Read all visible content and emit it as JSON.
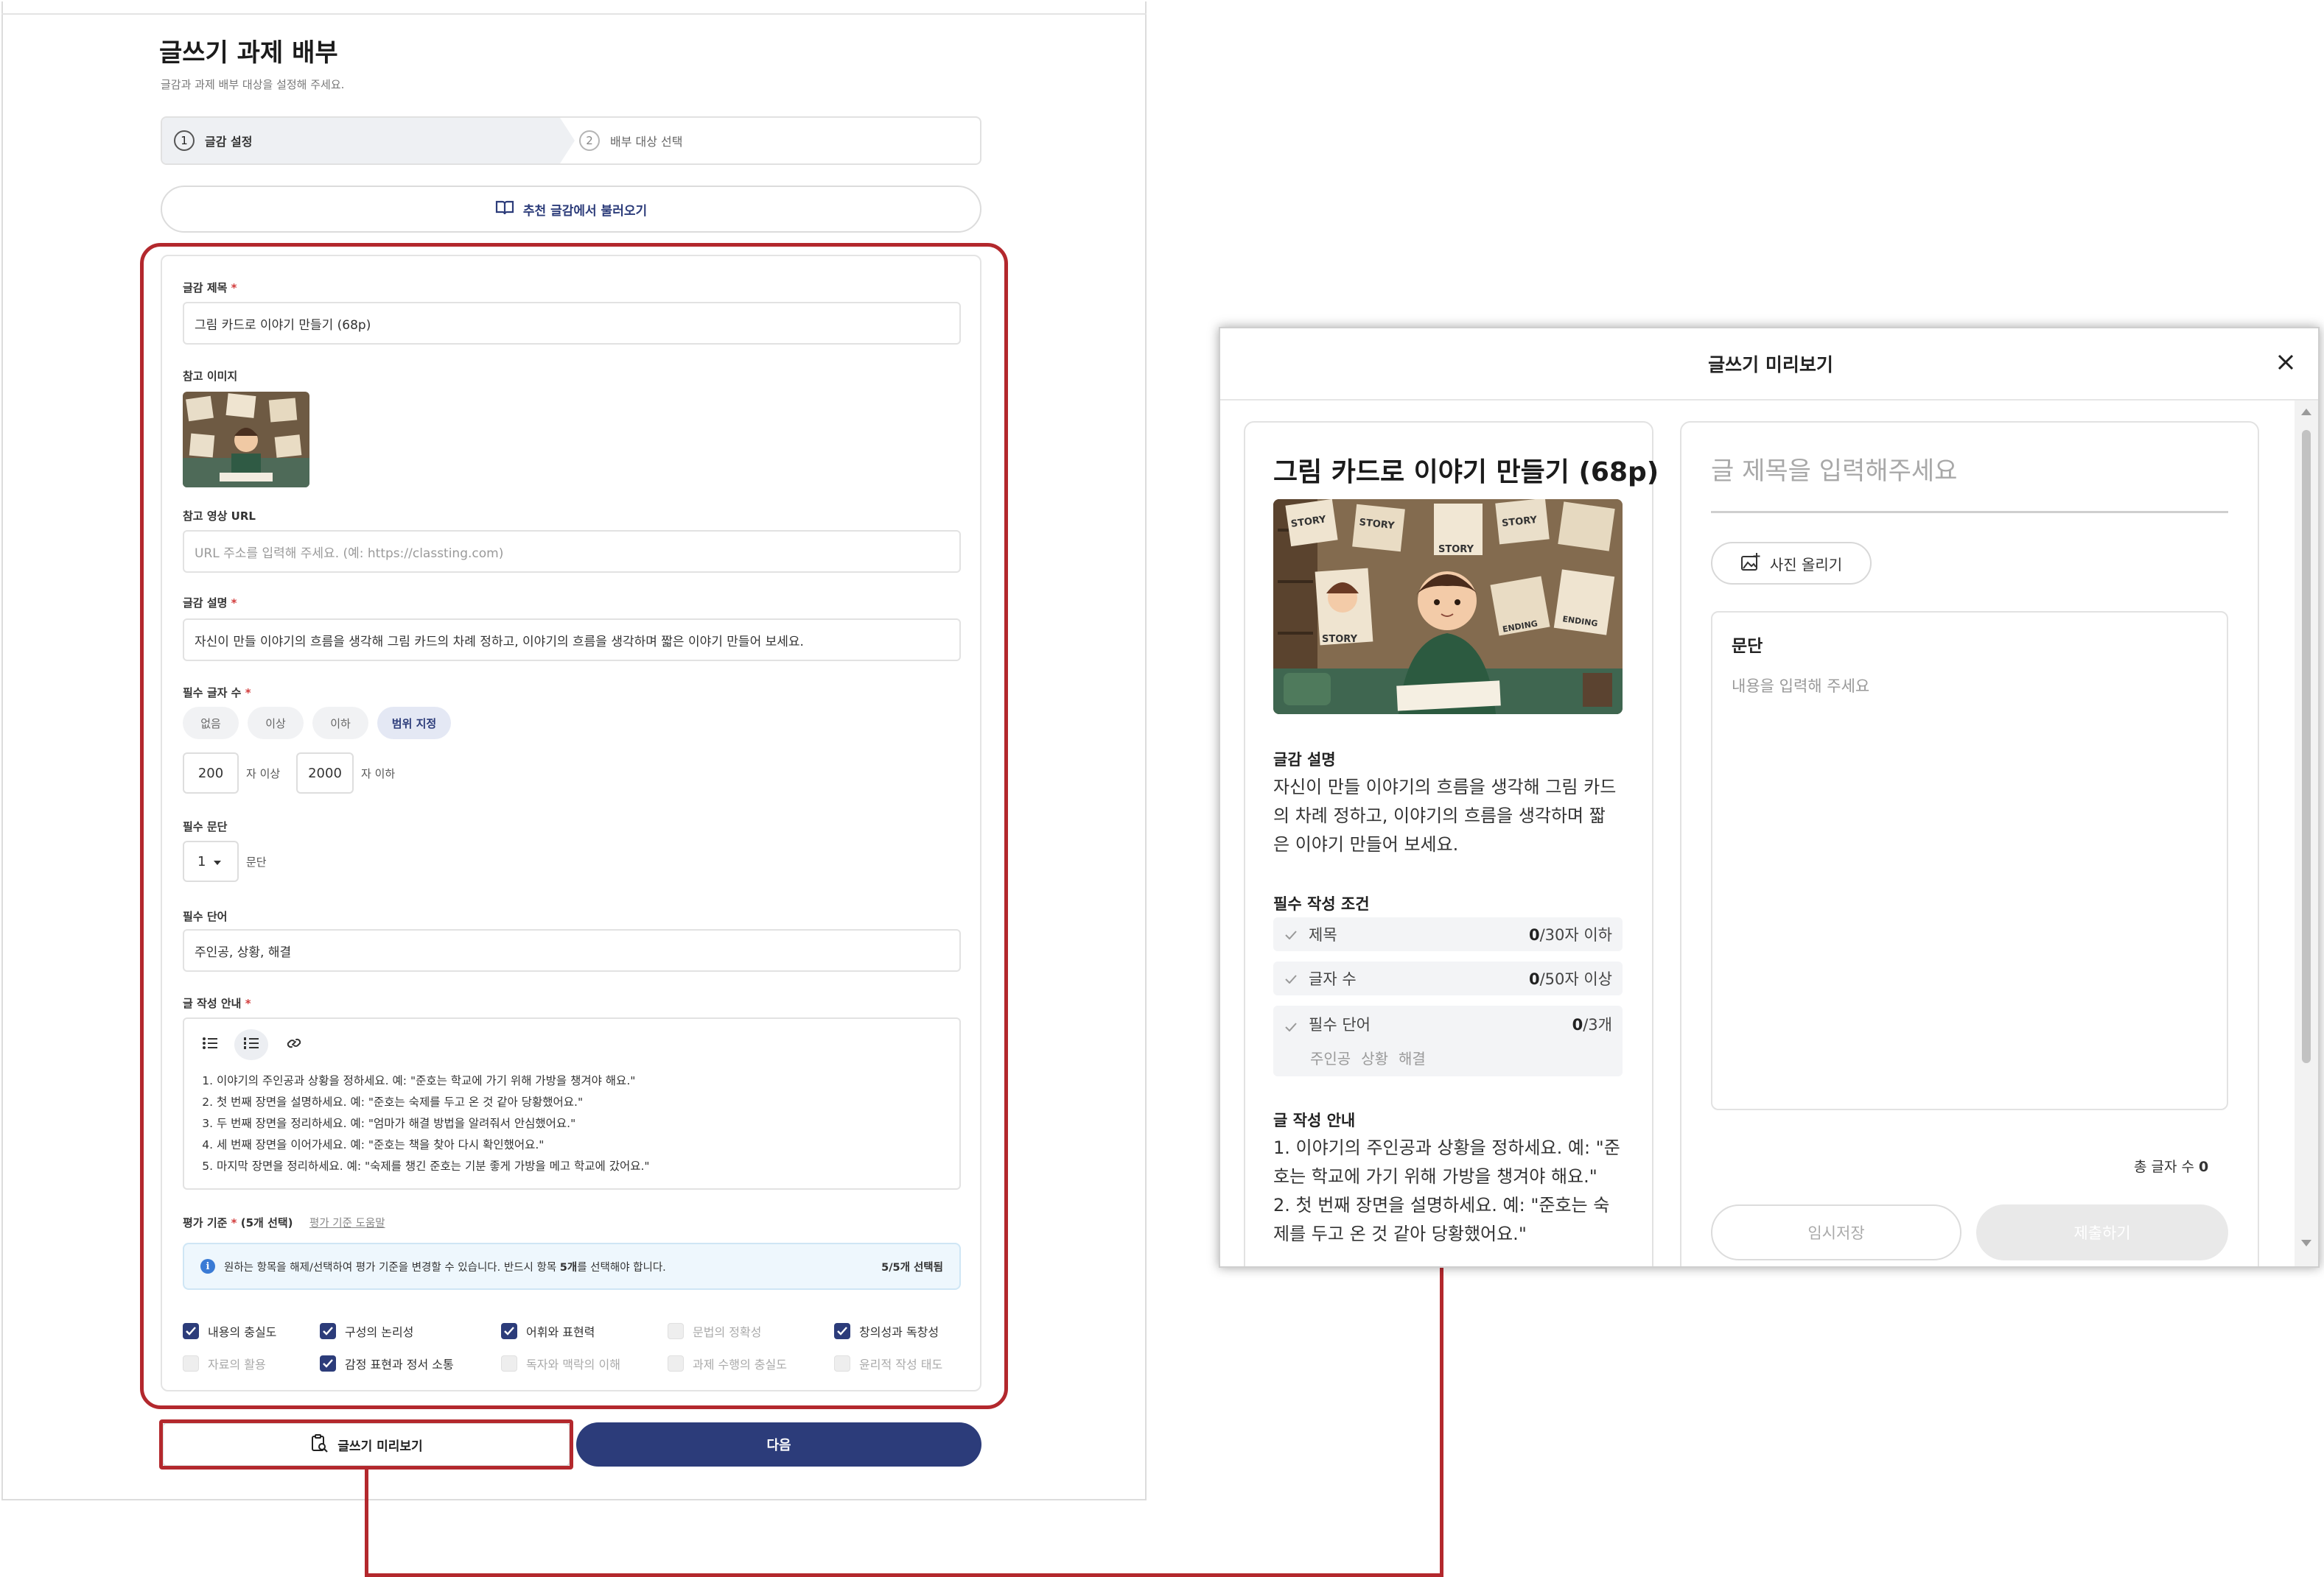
{
  "form": {
    "title": "글쓰기 과제 배부",
    "subtitle": "글감과 과제 배부 대상을 설정해 주세요.",
    "steps": [
      {
        "num": "1",
        "label": "글감 설정"
      },
      {
        "num": "2",
        "label": "배부 대상 선택"
      }
    ],
    "load_button": "추천 글감에서 불러오기",
    "topic_title_label": "글감 제목",
    "required_mark": "*",
    "topic_title_value": "그림 카드로 이야기 만들기 (68p)",
    "ref_image_label": "참고 이미지",
    "ref_video_label": "참고 영상 URL",
    "ref_video_placeholder": "URL 주소를 입력해 주세요. (예: https://classting.com)",
    "desc_label": "글감 설명",
    "desc_value": "자신이 만들 이야기의 흐름을 생각해 그림 카드의 차례 정하고, 이야기의 흐름을 생각하며 짧은 이야기 만들어 보세요.",
    "char_count_label": "필수 글자 수",
    "char_options": [
      "없음",
      "이상",
      "이하",
      "범위 지정"
    ],
    "char_min": "200",
    "char_min_unit": "자 이상",
    "char_max": "2000",
    "char_max_unit": "자 이하",
    "paragraph_label": "필수 문단",
    "paragraph_value": "1",
    "paragraph_unit": "문단",
    "words_label": "필수 단어",
    "words_value": "주인공, 상황, 해결",
    "guide_label": "글 작성 안내",
    "guide_items": [
      "이야기의 주인공과 상황을 정하세요. 예: \"준호는 학교에 가기 위해 가방을 챙겨야 해요.\"",
      "첫 번째 장면을 설명하세요. 예: \"준호는 숙제를 두고 온 것 같아 당황했어요.\"",
      "두 번째 장면을 정리하세요. 예: \"엄마가 해결 방법을 알려줘서 안심했어요.\"",
      "세 번째 장면을 이어가세요. 예: \"준호는 책을 찾아 다시 확인했어요.\"",
      "마지막 장면을 정리하세요. 예: \"숙제를 챙긴 준호는 기분 좋게 가방을 메고 학교에 갔어요.\""
    ],
    "criteria_label": "평가 기준",
    "criteria_count": "(5개 선택)",
    "criteria_help": "평가 기준 도움말",
    "info_text_a": "원하는 항목을 해제/선택하여 평가 기준을 변경할 수 있습니다. 반드시 항목 ",
    "info_text_bold": "5개",
    "info_text_b": "를 선택해야 합니다.",
    "info_count": "5/5개 선택됨",
    "criteria": [
      {
        "label": "내용의 충실도",
        "checked": true
      },
      {
        "label": "구성의 논리성",
        "checked": true
      },
      {
        "label": "어휘와 표현력",
        "checked": true
      },
      {
        "label": "문법의 정확성",
        "checked": false
      },
      {
        "label": "창의성과 독창성",
        "checked": true
      },
      {
        "label": "자료의 활용",
        "checked": false
      },
      {
        "label": "감정 표현과 정서 소통",
        "checked": true
      },
      {
        "label": "독자와 맥락의 이해",
        "checked": false
      },
      {
        "label": "과제 수행의 충실도",
        "checked": false
      },
      {
        "label": "윤리적 작성 태도",
        "checked": false
      }
    ],
    "preview_button": "글쓰기 미리보기",
    "next_button": "다음"
  },
  "preview": {
    "title": "글쓰기 미리보기",
    "topic_title": "그림 카드로 이야기 만들기 (68p)",
    "desc_heading": "글감 설명",
    "desc_lines": [
      "자신이 만들 이야기의 흐름을 생각해 그림 카드",
      "의 차례 정하고, 이야기의 흐름을 생각하며 짧",
      "은 이야기 만들어 보세요."
    ],
    "conditions_heading": "필수 작성 조건",
    "conditions": [
      {
        "label": "제목",
        "count": "0",
        "suffix": "/30자 이하"
      },
      {
        "label": "글자 수",
        "count": "0",
        "suffix": "/50자 이상"
      },
      {
        "label": "필수 단어",
        "count": "0",
        "suffix": "/3개"
      }
    ],
    "required_words": [
      "주인공",
      "상황",
      "해결"
    ],
    "guide_heading": "글 작성 안내",
    "guide_lines": [
      "1. 이야기의 주인공과 상황을 정하세요. 예: \"준",
      "호는 학교에 가기 위해 가방을 챙겨야 해요.\"",
      "2. 첫 번째 장면을 설명하세요. 예: \"준호는 숙",
      "제를 두고 온 것 같아 당황했어요.\""
    ],
    "write_title_placeholder": "글 제목을 입력해주세요",
    "upload_button": "사진 올리기",
    "paragraph_heading": "문단",
    "paragraph_placeholder": "내용을 입력해 주세요",
    "total_label": "총 글자 수",
    "total_value": "0",
    "save_button": "임시저장",
    "submit_button": "제출하기",
    "image_labels": [
      "STORY",
      "STORY",
      "STORY",
      "STORY",
      "STORY",
      "ENDING",
      "ENDING"
    ]
  },
  "colors": {
    "primary": "#2c3c7a",
    "highlight": "#b3282d",
    "info_bg": "#eef7fd",
    "required": "#d23c3c"
  },
  "icons": [
    "book-icon",
    "clipboard-search-icon",
    "image-upload-icon",
    "close-icon",
    "check-icon",
    "bullet-list-icon",
    "numbered-list-icon",
    "link-icon",
    "info-icon",
    "chevron-down-icon"
  ]
}
